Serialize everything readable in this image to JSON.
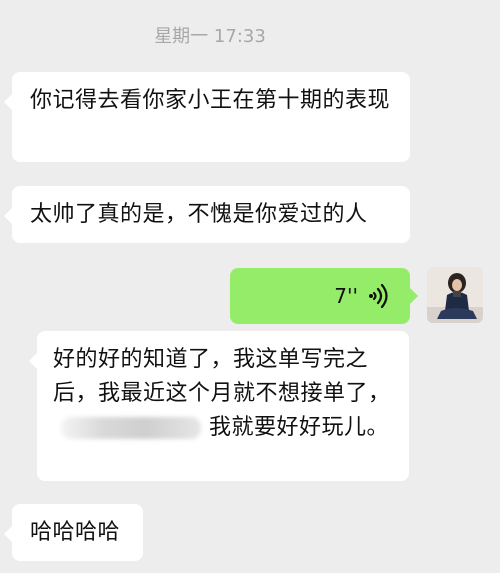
{
  "timestamp": "星期一 17:33",
  "messages": {
    "m1": {
      "text": "你记得去看你家小王在第十期的表现"
    },
    "m2": {
      "text": "太帅了真的是，不愧是你爱过的人"
    },
    "m3": {
      "text_before": "好的好的知道了，我这单写完之后，我最近这个月就不想接单了，",
      "text_after": "我就要好好玩儿。"
    },
    "m4": {
      "text": "哈哈哈哈"
    },
    "voice": {
      "duration": "7''",
      "bubble_color": "#95ec69",
      "icon": "voice-wave-icon"
    }
  },
  "colors": {
    "background": "#ededed",
    "bubble_left": "#ffffff",
    "bubble_right": "#95ec69",
    "timestamp": "#a8a8a8"
  }
}
